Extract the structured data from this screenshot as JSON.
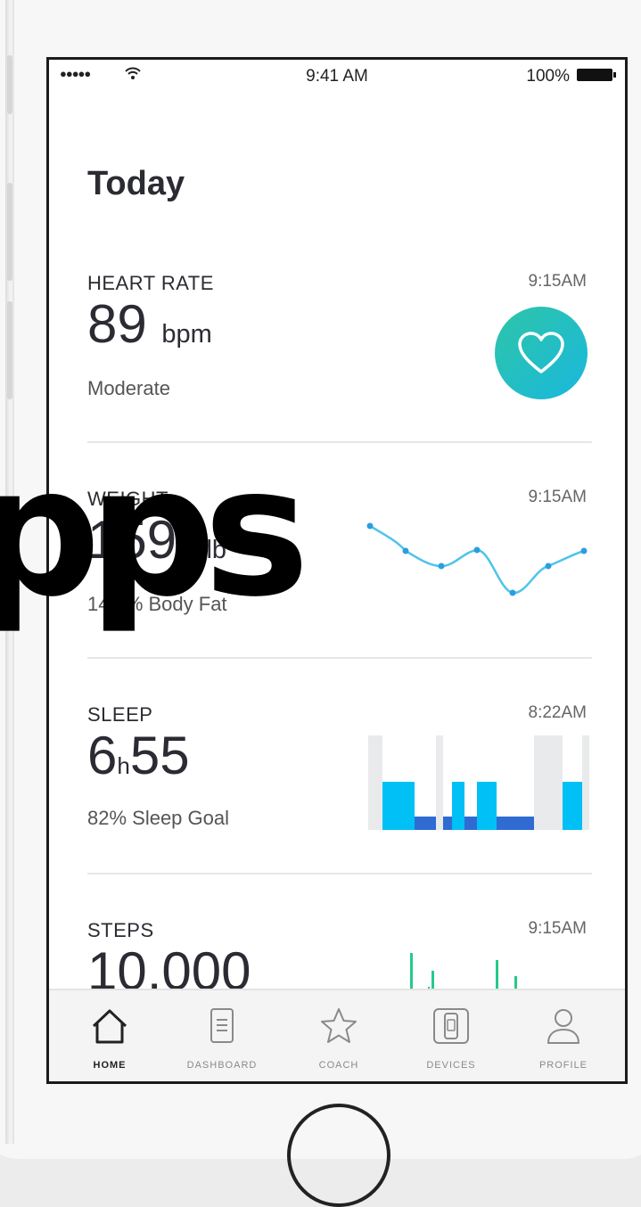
{
  "status_bar": {
    "signal": "●●●●●",
    "time": "9:41 AM",
    "battery": "100%"
  },
  "page": {
    "title": "Today"
  },
  "cards": {
    "heart_rate": {
      "label": "HEART RATE",
      "time": "9:15AM",
      "value": "89",
      "unit": "bpm",
      "sub": "Moderate",
      "icon": "heart-icon",
      "accent_colors": [
        "#2ec5a7",
        "#19b8de"
      ]
    },
    "weight": {
      "label": "WEIGHT",
      "time": "9:15AM",
      "value": "159.",
      "unit": "lb",
      "sub": "14.3% Body Fat",
      "line_color": "#4fc3ea",
      "trend_points": [
        588,
        615,
        632,
        614,
        662,
        632,
        615
      ]
    },
    "sleep": {
      "label": "SLEEP",
      "time": "8:22AM",
      "value_hours": "6",
      "value_h": "h",
      "value_minutes": "55",
      "sub": "82% Sleep Goal",
      "colors": {
        "deep": "#00c0f5",
        "light": "#2f6bd2",
        "awake": "#e8eaec"
      }
    },
    "steps": {
      "label": "STEPS",
      "time": "9:15AM",
      "value": "10,000",
      "bar_color": "#26c98a"
    }
  },
  "tabs": [
    {
      "label": "HOME",
      "icon": "home-icon",
      "active": true
    },
    {
      "label": "DASHBOARD",
      "icon": "dashboard-icon",
      "active": false
    },
    {
      "label": "COACH",
      "icon": "star-icon",
      "active": false
    },
    {
      "label": "DEVICES",
      "icon": "watch-icon",
      "active": false
    },
    {
      "label": "PROFILE",
      "icon": "profile-icon",
      "active": false
    }
  ],
  "overlay": {
    "text": "pps"
  }
}
